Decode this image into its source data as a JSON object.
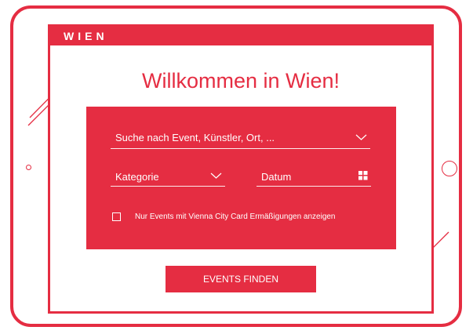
{
  "brand": {
    "logo_text": "WIEN"
  },
  "hero": {
    "title": "Willkommen in Wien!"
  },
  "search": {
    "placeholder": "Suche nach Event, Künstler, Ort, ...",
    "chevron_icon": "chevron-down-icon"
  },
  "filters": {
    "category_label": "Kategorie",
    "category_icon": "chevron-down-icon",
    "date_label": "Datum",
    "date_icon": "calendar-grid-icon"
  },
  "vienna_card": {
    "checked": false,
    "label": "Nur Events mit Vienna City Card Ermäßigungen anzeigen"
  },
  "submit": {
    "label": "EVENTS FINDEN"
  },
  "colors": {
    "accent": "#e52d42",
    "text_on_accent": "#ffffff",
    "background": "#ffffff"
  }
}
